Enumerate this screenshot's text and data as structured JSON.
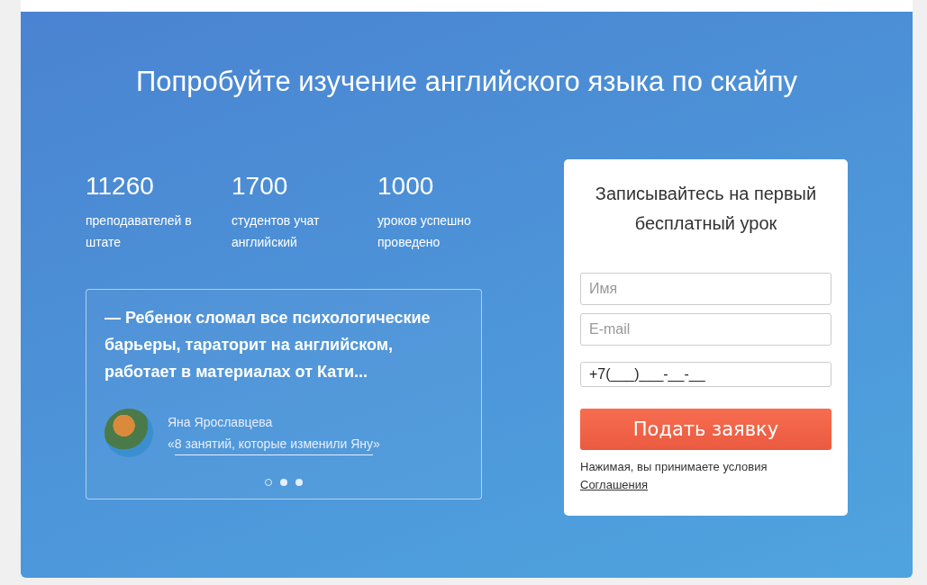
{
  "heading": "Попробуйте изучение английского языка по скайпу",
  "stats": [
    {
      "number": "11260",
      "caption": "преподавателей в штате"
    },
    {
      "number": "1700",
      "caption": "студентов учат английский"
    },
    {
      "number": "1000",
      "caption": "уроков успешно проведено"
    }
  ],
  "testimonial": {
    "quote": "— Ребенок сломал все психологические барьеры, тараторит на английском, работает в материалах от Кати...",
    "author": "Яна Ярославцева",
    "link_open": "«",
    "link": "8 занятий, которые изменили Яну",
    "link_close": "»",
    "slides": [
      {
        "selected": true
      },
      {
        "selected": false
      },
      {
        "selected": false
      }
    ]
  },
  "form": {
    "title": "Записывайтесь на первый бесплатный урок",
    "fields": [
      {
        "placeholder": "Имя"
      },
      {
        "placeholder": "E-mail"
      },
      {
        "value": "+7(___)___-__-__"
      }
    ],
    "submit": "Подать заявку",
    "note": "Нажимая, вы принимаете условия",
    "note_link": "Соглашения"
  }
}
